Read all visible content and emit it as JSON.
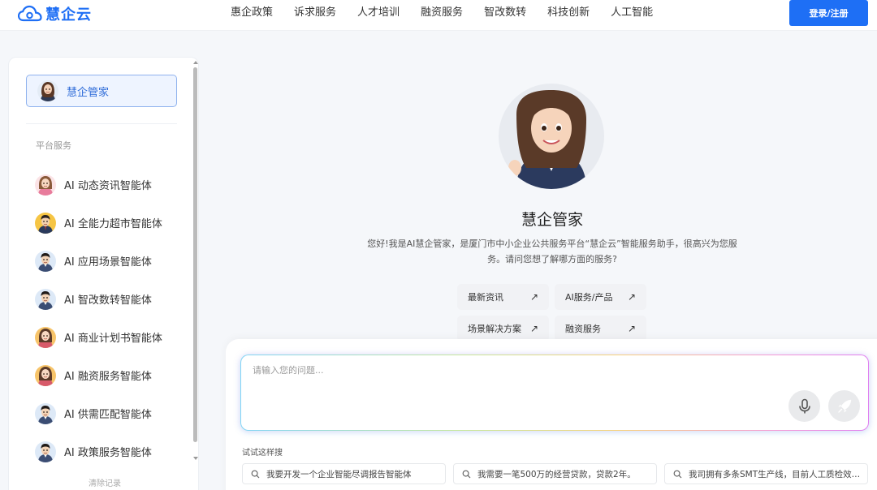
{
  "header": {
    "logo_text": "慧企云",
    "nav": [
      "惠企政策",
      "诉求服务",
      "人才培训",
      "融资服务",
      "智改数转",
      "科技创新",
      "人工智能"
    ],
    "login_label": "登录/注册"
  },
  "sidebar": {
    "current": "慧企管家",
    "section_title": "平台服务",
    "items": [
      {
        "label": "AI 动态资讯智能体"
      },
      {
        "label": "AI 全能力超市智能体"
      },
      {
        "label": "AI 应用场景智能体"
      },
      {
        "label": "AI 智改数转智能体"
      },
      {
        "label": "AI 商业计划书智能体"
      },
      {
        "label": "AI 融资服务智能体"
      },
      {
        "label": "AI 供需匹配智能体"
      },
      {
        "label": "AI 政策服务智能体"
      }
    ],
    "clear_label": "清除记录"
  },
  "main": {
    "title": "慧企管家",
    "description": "您好!我是AI慧企管家，是厦门市中小企业公共服务平台“慧企云”智能服务助手，很高兴为您服务。请问您想了解哪方面的服务?",
    "quick_links": [
      {
        "label": "最新资讯",
        "arrow": "↗"
      },
      {
        "label": "AI服务/产品",
        "arrow": "↗"
      },
      {
        "label": "场景解决方案",
        "arrow": "↗"
      },
      {
        "label": "融资服务",
        "arrow": "↗"
      }
    ]
  },
  "input": {
    "placeholder": "请输入您的问题...",
    "try_label": "试试这样搜",
    "suggestions": [
      "我要开发一个企业智能尽调报告智能体",
      "我需要一笔500万的经营贷款，贷款2年。",
      "我司拥有多条SMT生产线，目前人工质检效率低"
    ]
  },
  "colors": {
    "brand": "#1e6ff5",
    "active_border": "#8fb2ee",
    "active_bg": "#eef4ff"
  }
}
